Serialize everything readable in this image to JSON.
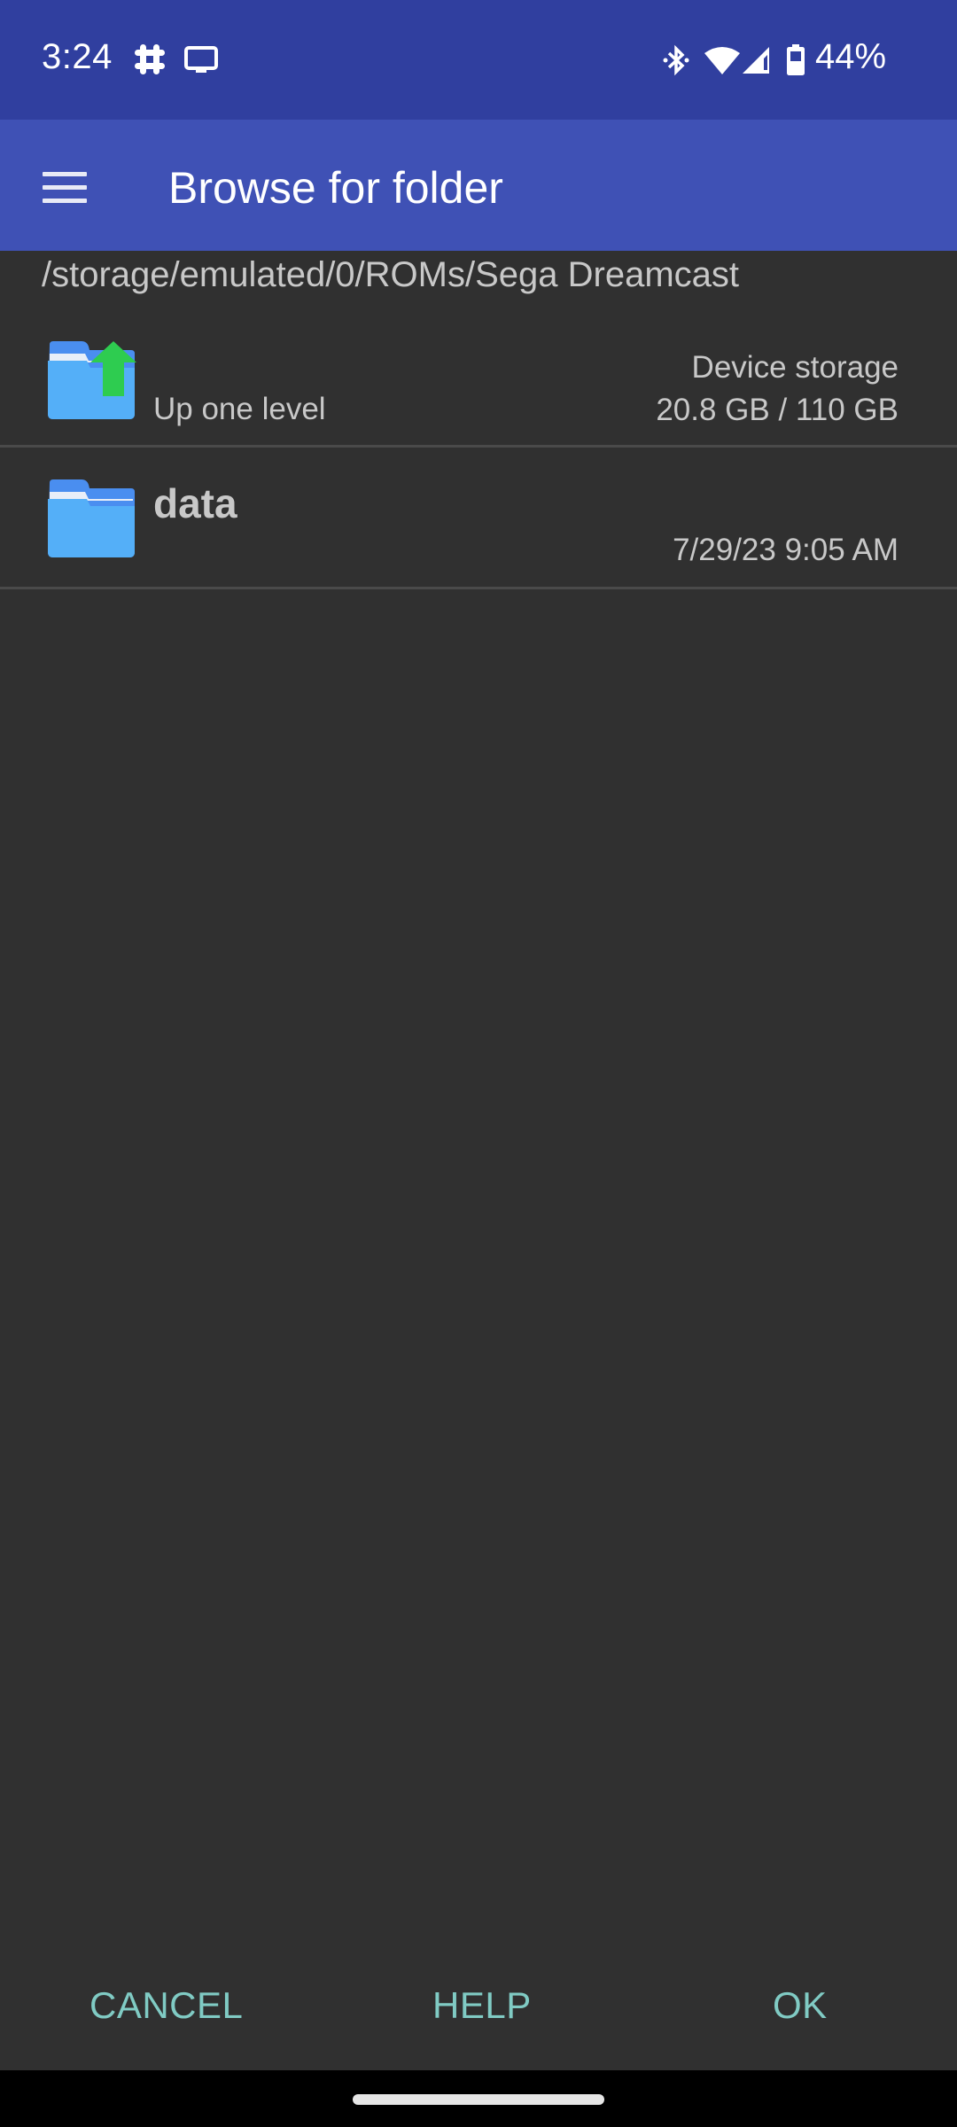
{
  "status_bar": {
    "time": "3:24",
    "left_icons": [
      "slack-icon",
      "cast-screen-icon"
    ],
    "right_icons": [
      "bluetooth-icon",
      "wifi-icon",
      "cell-signal-icon",
      "battery-icon"
    ],
    "battery_percent": "44%"
  },
  "app_bar": {
    "menu_icon": "hamburger-menu-icon",
    "title": "Browse for folder"
  },
  "path": "/storage/emulated/0/ROMs/Sega Dreamcast",
  "list": {
    "items": [
      {
        "icon": "folder-up-icon",
        "label": "Up one level",
        "meta_top": "Device storage",
        "meta_bottom": "20.8 GB / 110 GB"
      },
      {
        "icon": "folder-icon",
        "label": "data",
        "meta_top": "",
        "meta_bottom": "7/29/23 9:05 AM"
      }
    ]
  },
  "buttons": {
    "cancel": "CANCEL",
    "help": "HELP",
    "ok": "OK"
  },
  "colors": {
    "status_bar": "#303f9f",
    "app_bar": "#3f51b5",
    "background": "#303030",
    "button_text": "#80cbc4",
    "folder": "#54aff8",
    "up_arrow": "#2ecc50"
  }
}
